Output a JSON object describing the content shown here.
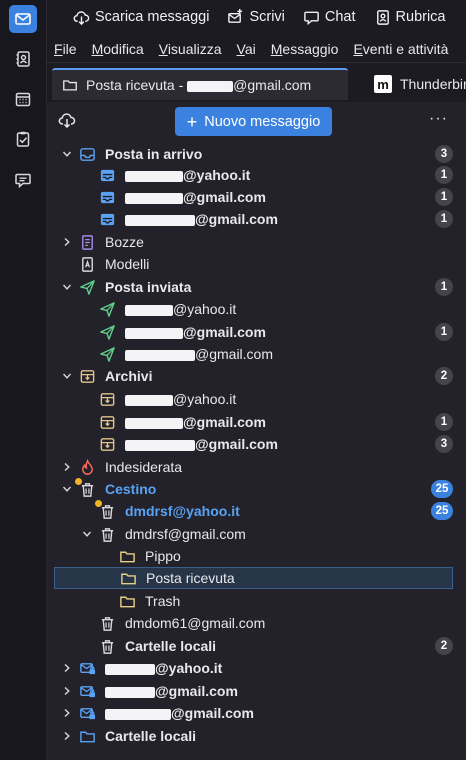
{
  "toolbar": {
    "get_messages": "Scarica messaggi",
    "write": "Scrivi",
    "chat": "Chat",
    "address_book": "Rubrica"
  },
  "menu": [
    "File",
    "Modifica",
    "Visualizza",
    "Vai",
    "Messaggio",
    "Eventi e attività"
  ],
  "tabs": {
    "active": {
      "label_prefix": "Posta ricevuta - ",
      "label_suffix": "@gmail.com"
    },
    "other": {
      "label": "Thunderbird"
    }
  },
  "pane": {
    "new_message": "Nuovo messaggio"
  },
  "colors": {
    "accent": "#3b82e0",
    "unread_blue": "#5aa2f4"
  },
  "folders": [
    {
      "label": "Posta in arrivo",
      "bold": true,
      "badge": "3"
    },
    {
      "label": "@yahoo.it",
      "bold": true,
      "badge": "1"
    },
    {
      "label": "@gmail.com",
      "bold": true,
      "badge": "1"
    },
    {
      "label": "@gmail.com",
      "bold": true,
      "badge": "1"
    },
    {
      "label": "Bozze"
    },
    {
      "label": "Modelli"
    },
    {
      "label": "Posta inviata",
      "bold": true,
      "badge": "1"
    },
    {
      "label": "@yahoo.it"
    },
    {
      "label": "@gmail.com",
      "bold": true,
      "badge": "1"
    },
    {
      "label": "@gmail.com"
    },
    {
      "label": "Archivi",
      "bold": true,
      "badge": "2"
    },
    {
      "label": "@yahoo.it"
    },
    {
      "label": "@gmail.com",
      "bold": true,
      "badge": "1"
    },
    {
      "label": "@gmail.com",
      "bold": true,
      "badge": "3"
    },
    {
      "label": "Indesiderata"
    },
    {
      "label": "Cestino",
      "badge": "25"
    },
    {
      "label": "dmdrsf@yahoo.it",
      "badge": "25"
    },
    {
      "label": "dmdrsf@gmail.com"
    },
    {
      "label": "Pippo"
    },
    {
      "label": "Posta ricevuta"
    },
    {
      "label": "Trash"
    },
    {
      "label": "dmdom61@gmail.com"
    },
    {
      "label": "Cartelle locali",
      "bold": true,
      "badge": "2"
    },
    {
      "label": "@yahoo.it",
      "bold": true
    },
    {
      "label": "@gmail.com",
      "bold": true
    },
    {
      "label": "@gmail.com",
      "bold": true
    },
    {
      "label": "Cartelle locali",
      "bold": true
    }
  ]
}
